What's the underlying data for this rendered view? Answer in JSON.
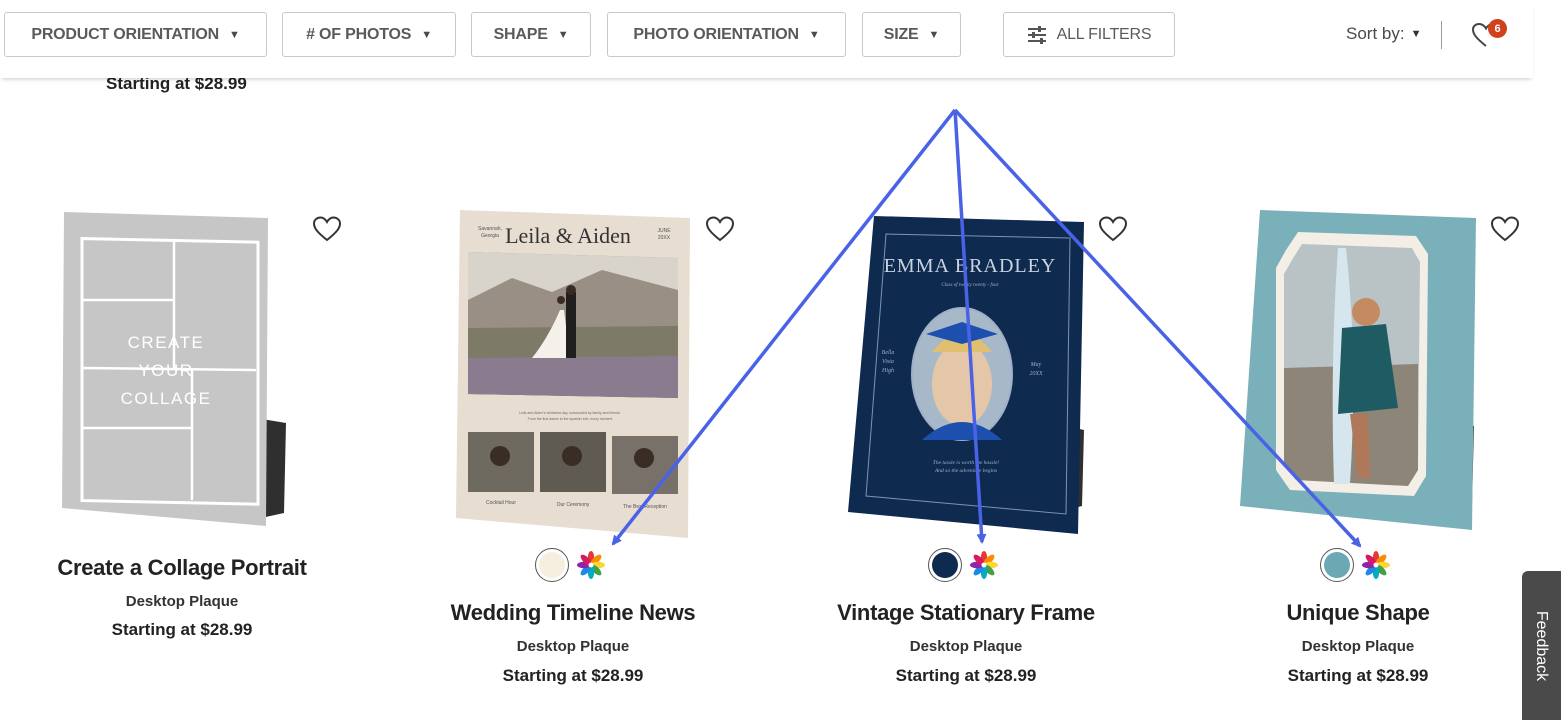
{
  "filters": [
    {
      "label": "PRODUCT ORIENTATION"
    },
    {
      "label": "# OF PHOTOS"
    },
    {
      "label": "SHAPE"
    },
    {
      "label": "PHOTO ORIENTATION"
    },
    {
      "label": "SIZE"
    }
  ],
  "all_filters_label": "ALL FILTERS",
  "sort_label": "Sort by:",
  "favorites_count": "6",
  "top_row_price": "Starting at $28.99",
  "products": [
    {
      "title": "Create a Collage Portrait",
      "type": "Desktop Plaque",
      "price": "Starting at $28.99",
      "collage_text": [
        "CREATE",
        "YOUR",
        "COLLAGE"
      ]
    },
    {
      "title": "Wedding Timeline News",
      "type": "Desktop Plaque",
      "price": "Starting at $28.99",
      "swatch_color": "#f6efdf",
      "plaque_text": {
        "heading": "Leila & Aiden",
        "left": [
          "Savannah,",
          "Georgia"
        ],
        "right": [
          "JUNE",
          "20XX"
        ],
        "captions": [
          "Cocktail Hour",
          "Our Ceremony",
          "The Best Reception"
        ]
      }
    },
    {
      "title": "Vintage Stationary Frame",
      "type": "Desktop Plaque",
      "price": "Starting at $28.99",
      "swatch_color": "#0e2a4f",
      "plaque_text": {
        "heading": "EMMA BRADLEY",
        "sub": "Class of twenty twenty - four",
        "left": [
          "Bella",
          "Vista",
          "High"
        ],
        "right": [
          "May",
          "20XX"
        ],
        "quote": [
          "The tassle is worth the hassle!",
          "And so the adventure begins"
        ]
      }
    },
    {
      "title": "Unique Shape",
      "type": "Desktop Plaque",
      "price": "Starting at $28.99",
      "swatch_color": "#6aa8b3"
    }
  ],
  "feedback_label": "Feedback",
  "colors": {
    "accent_arrow": "#4a63e6",
    "badge": "#d0421b",
    "navy": "#0e2a4f",
    "teal": "#7ab0b9"
  }
}
